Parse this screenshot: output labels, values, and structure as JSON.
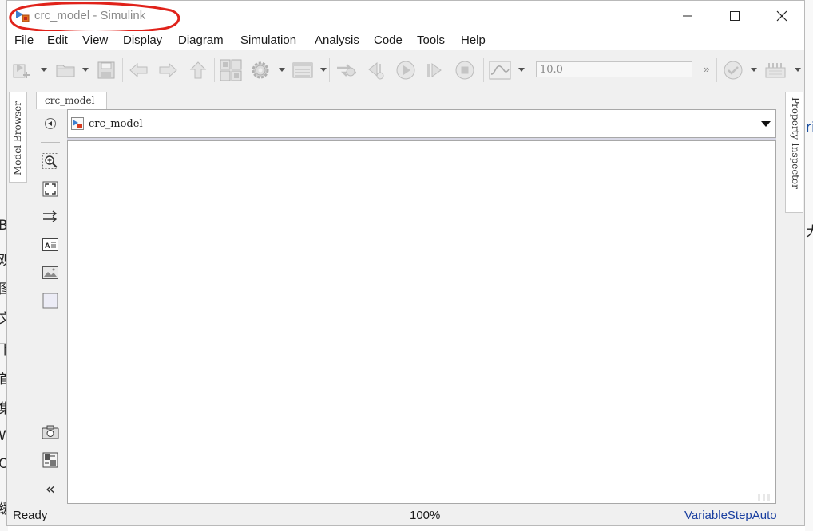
{
  "window": {
    "title": "crc_model - Simulink",
    "model_name": "crc_model"
  },
  "menu": [
    "File",
    "Edit",
    "View",
    "Display",
    "Diagram",
    "Simulation",
    "Analysis",
    "Code",
    "Tools",
    "Help"
  ],
  "toolbar": {
    "stop_time": "10.0",
    "overflow": "»"
  },
  "side_tabs": {
    "left": "Model Browser",
    "right": "Property Inspector"
  },
  "editor": {
    "tab_label": "crc_model",
    "address": "crc_model"
  },
  "palette": {
    "collapse_glyph": "«"
  },
  "status": {
    "state": "Ready",
    "zoom": "100%",
    "solver": "VariableStepAuto"
  },
  "background": {
    "left_chars": [
      "B",
      "观",
      "图",
      "文",
      "下",
      "首",
      "集",
      "W",
      "O",
      "缓"
    ],
    "right_chars": [
      "ri",
      "大"
    ]
  },
  "colors": {
    "annotation": "#e0221a",
    "solver_link": "#1a3fa0"
  }
}
